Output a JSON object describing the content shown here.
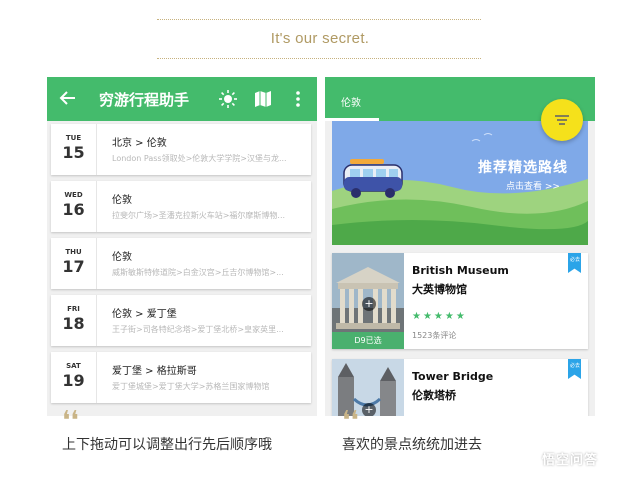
{
  "tagline": "It's our secret.",
  "left_app": {
    "title": "穷游行程助手",
    "trips": [
      {
        "dow": "TUE",
        "day": "15",
        "route": "北京 > 伦敦",
        "detail": "London Pass领取处>伦敦大学学院>汉堡与龙..."
      },
      {
        "dow": "WED",
        "day": "16",
        "route": "伦敦",
        "detail": "拉斐尔广场>圣潘克拉斯火车站>福尔摩斯博物..."
      },
      {
        "dow": "THU",
        "day": "17",
        "route": "伦敦",
        "detail": "威斯敏斯特修道院>白金汉宫>丘吉尔博物馆>..."
      },
      {
        "dow": "FRI",
        "day": "18",
        "route": "伦敦 > 爱丁堡",
        "detail": "王子街>司各特纪念塔>爱丁堡北桥>皇家英里..."
      },
      {
        "dow": "SAT",
        "day": "19",
        "route": "爱丁堡 > 格拉斯哥",
        "detail": "爱丁堡城堡>爱丁堡大学>苏格兰国家博物馆"
      }
    ]
  },
  "right_app": {
    "tab": "伦敦",
    "banner": {
      "title": "推荐精选路线",
      "subtitle": "点击查看 >>"
    },
    "pois": [
      {
        "en": "British Museum",
        "cn": "大英博物馆",
        "stars": "★★★★★",
        "reviews": "1523条评论",
        "visited": "D9已选",
        "ribbon": "必去"
      },
      {
        "en": "Tower Bridge",
        "cn": "伦敦塔桥",
        "ribbon": "必去"
      }
    ]
  },
  "captions": {
    "left": "上下拖动可以调整出行先后顺序哦",
    "right": "喜欢的景点统统加进去"
  },
  "watermark": "悟空问答",
  "colors": {
    "green": "#44bb6c",
    "fab_yellow": "#f5e11b",
    "gold": "#c9b487",
    "ribbon_blue": "#2ba4e8"
  }
}
